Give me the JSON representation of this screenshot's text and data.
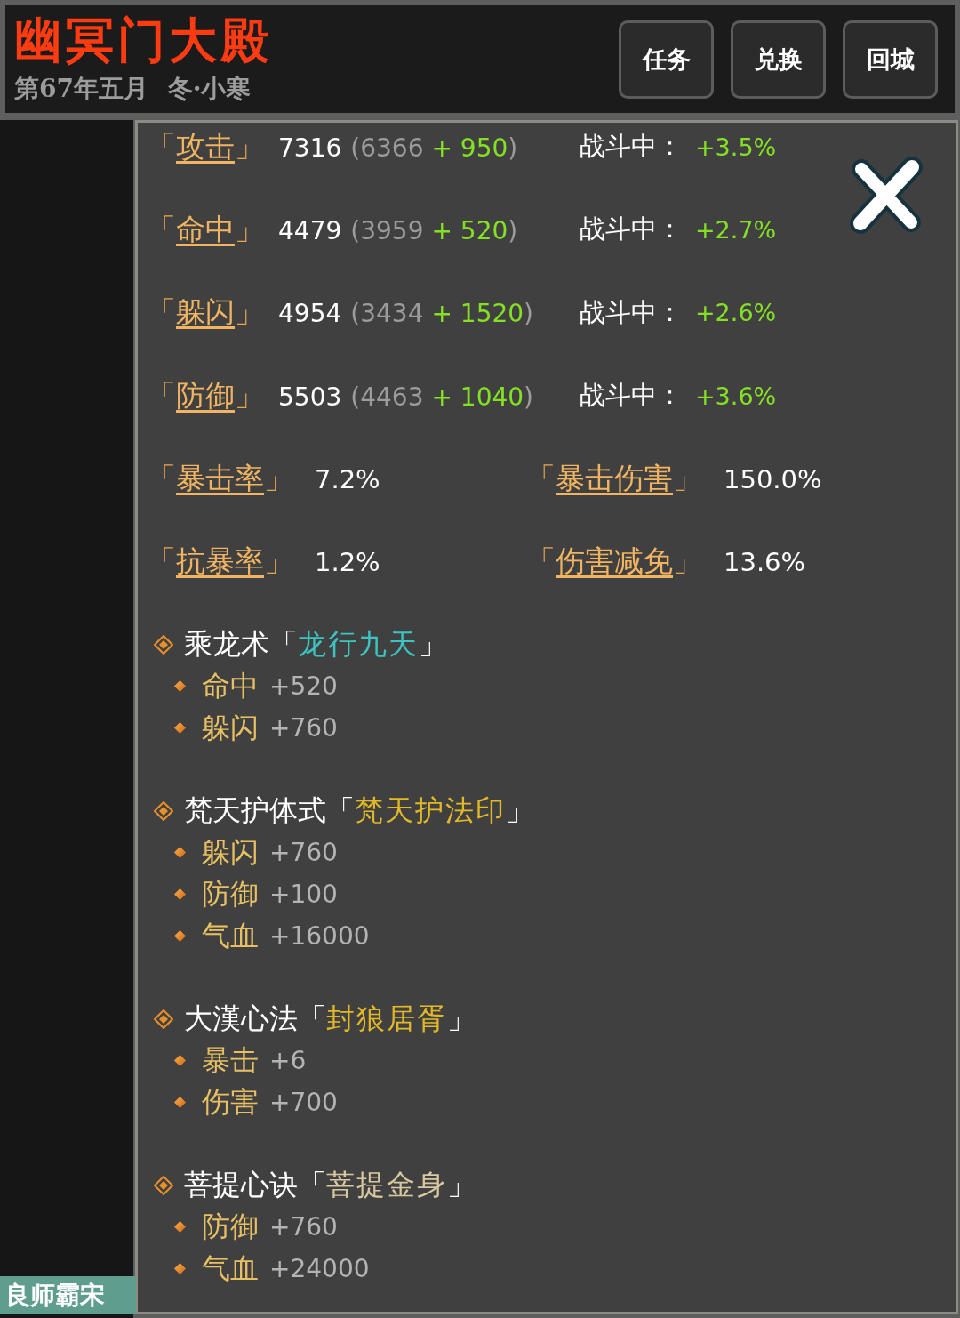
{
  "header": {
    "title": "幽冥门大殿",
    "date": "第67年五月 冬·小寒",
    "buttons": [
      "任务",
      "兑换",
      "回城"
    ]
  },
  "main_stats": [
    {
      "open": "「",
      "name": "攻击",
      "close": "」",
      "total": "7316",
      "base": "(6366",
      "bonus": "+ 950",
      "end": ")",
      "battle_label": "战斗中：",
      "battle_bonus": "+3.5%"
    },
    {
      "open": "「",
      "name": "命中",
      "close": "」",
      "total": "4479",
      "base": "(3959",
      "bonus": "+ 520",
      "end": ")",
      "battle_label": "战斗中：",
      "battle_bonus": "+2.7%"
    },
    {
      "open": "「",
      "name": "躲闪",
      "close": "」",
      "total": "4954",
      "base": "(3434",
      "bonus": "+ 1520",
      "end": ")",
      "battle_label": "战斗中：",
      "battle_bonus": "+2.6%"
    },
    {
      "open": "「",
      "name": "防御",
      "close": "」",
      "total": "5503",
      "base": "(4463",
      "bonus": "+ 1040",
      "end": ")",
      "battle_label": "战斗中：",
      "battle_bonus": "+3.6%"
    }
  ],
  "rates": [
    {
      "open": "「",
      "name": "暴击率",
      "close": "」",
      "value": "7.2%"
    },
    {
      "open": "「",
      "name": "暴击伤害",
      "close": "」",
      "value": "150.0%"
    },
    {
      "open": "「",
      "name": "抗暴率",
      "close": "」",
      "value": "1.2%"
    },
    {
      "open": "「",
      "name": "伤害减免",
      "close": "」",
      "value": "13.6%"
    }
  ],
  "techniques": [
    {
      "name": "乘龙术",
      "open": "「",
      "style": "龙行九天",
      "close": "」",
      "color": "#3cc4c0",
      "effects": [
        {
          "stat": "命中",
          "value": "+520"
        },
        {
          "stat": "躲闪",
          "value": "+760"
        }
      ]
    },
    {
      "name": "梵天护体式",
      "open": "「",
      "style": "梵天护法印",
      "close": "」",
      "color": "#e0b828",
      "effects": [
        {
          "stat": "躲闪",
          "value": "+760"
        },
        {
          "stat": "防御",
          "value": "+100"
        },
        {
          "stat": "气血",
          "value": "+16000"
        }
      ]
    },
    {
      "name": "大漢心法",
      "open": "「",
      "style": "封狼居胥",
      "close": "」",
      "color": "#e0b828",
      "effects": [
        {
          "stat": "暴击",
          "value": "+6"
        },
        {
          "stat": "伤害",
          "value": "+700"
        }
      ]
    },
    {
      "name": "菩提心诀",
      "open": "「",
      "style": "菩提金身",
      "close": "」",
      "color": "#d8c8a0",
      "effects": [
        {
          "stat": "防御",
          "value": "+760"
        },
        {
          "stat": "气血",
          "value": "+24000"
        }
      ]
    }
  ],
  "sidebar": {
    "tag": "良师霸宋"
  }
}
